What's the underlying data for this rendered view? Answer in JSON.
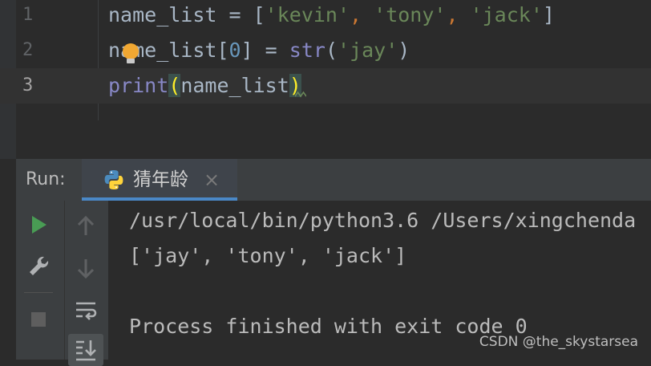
{
  "editor": {
    "lines": [
      {
        "number": "1",
        "tokens": {
          "t1": "name_list = [",
          "t2": "'kevin'",
          "t3": ", ",
          "t4": "'tony'",
          "t5": ", ",
          "t6": "'jack'",
          "t7": "]"
        }
      },
      {
        "number": "2",
        "tokens": {
          "t1": "name_list[",
          "t2": "0",
          "t3": "] = ",
          "t4": "str",
          "t5": "(",
          "t6": "'jay'",
          "t7": ")"
        }
      },
      {
        "number": "3",
        "tokens": {
          "t1": "print",
          "t2": "(",
          "t3": "name_list",
          "t4": ")"
        }
      }
    ],
    "current_line": 3
  },
  "run": {
    "label": "Run:",
    "tab_title": "猜年龄",
    "close_glyph": "×",
    "output": [
      "/usr/local/bin/python3.6 /Users/xingchenda",
      "['jay', 'tony', 'jack']",
      "",
      "Process finished with exit code 0"
    ]
  },
  "watermark": "CSDN @the_skystarsea",
  "colors": {
    "editor_bg": "#2b2b2b",
    "string": "#6a8759",
    "keyword_punct": "#cc7832",
    "number": "#6897bb",
    "builtin": "#8888c6",
    "paren_highlight": "#ffef28",
    "run_green": "#499c54",
    "tab_underline": "#4a88c7"
  },
  "icons": [
    "lightbulb-icon",
    "python-icon",
    "close-icon",
    "run-icon",
    "wrench-icon",
    "stop-icon",
    "up-arrow-icon",
    "down-arrow-icon",
    "soft-wrap-icon",
    "scroll-to-end-icon"
  ]
}
